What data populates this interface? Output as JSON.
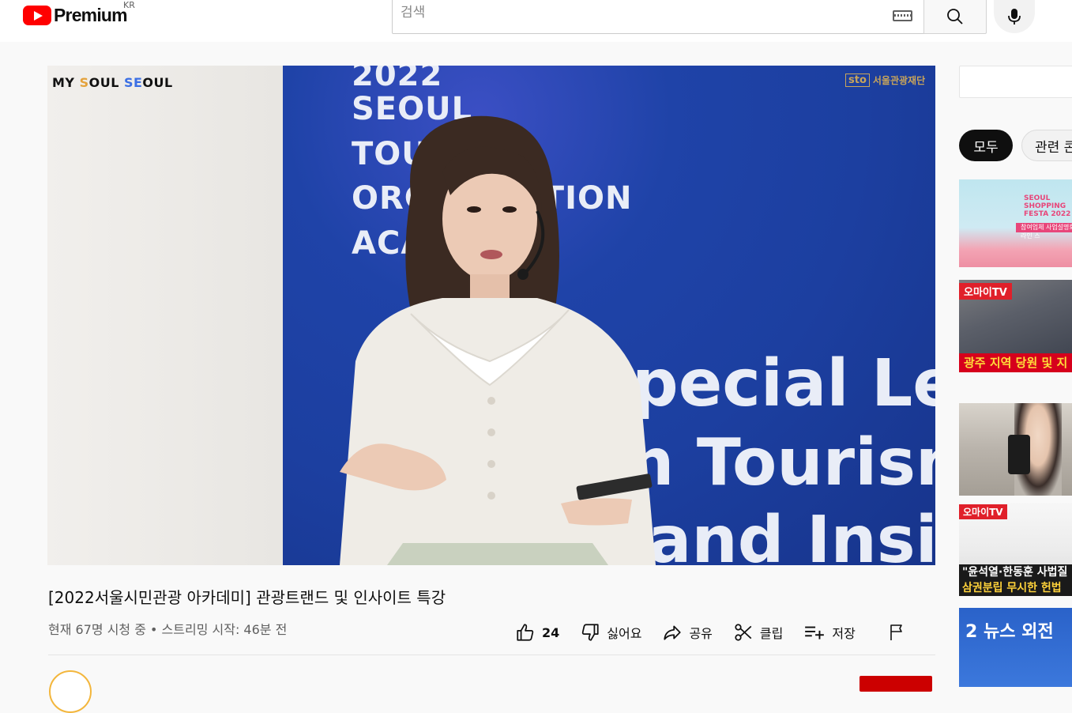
{
  "header": {
    "logo_text": "Premium",
    "country_code": "KR",
    "search_placeholder": "검색"
  },
  "video": {
    "title": "[2022서울시민관광 아카데미] 관광트랜드 및 인사이트 특강",
    "meta": "현재 67명 시청 중 • 스트리밍 시작: 46분 전",
    "slide": {
      "brand": [
        "MY ",
        "S",
        "OUL ",
        "SE",
        "OUL"
      ],
      "org_logo": "sto",
      "org_name": "서울관광재단",
      "year": "2022",
      "line1": "SEOUL",
      "line2": "TOURISM",
      "line3": "ORGANIZATION",
      "line4": "ACADEMY",
      "big1": "pecial Lec",
      "big2": "n Tourism",
      "big3": "and Insight"
    }
  },
  "actions": {
    "like_count": "24",
    "dislike_label": "싫어요",
    "share_label": "공유",
    "clip_label": "클립",
    "save_label": "저장"
  },
  "sidebar": {
    "chips": [
      "모두",
      "관련 콘"
    ],
    "thumbs": [
      {
        "title": "SEOUL SHOPPING FESTA 2022",
        "band": "참여업체 사업설명회 온라인 스"
      },
      {
        "badge": "오마이TV",
        "caption": "광주 지역 당원 및 지"
      },
      {},
      {
        "badge": "오마이TV",
        "caption1": "\"윤석열·한동훈 사법질",
        "caption2": "삼권분립 무시한 헌법"
      },
      {
        "logo": "2 뉴스 외전"
      }
    ]
  },
  "colors": {
    "brand_red": "#ff0000",
    "banner_blue": "#1f43a8",
    "chip_active": "#0f0f0f"
  }
}
